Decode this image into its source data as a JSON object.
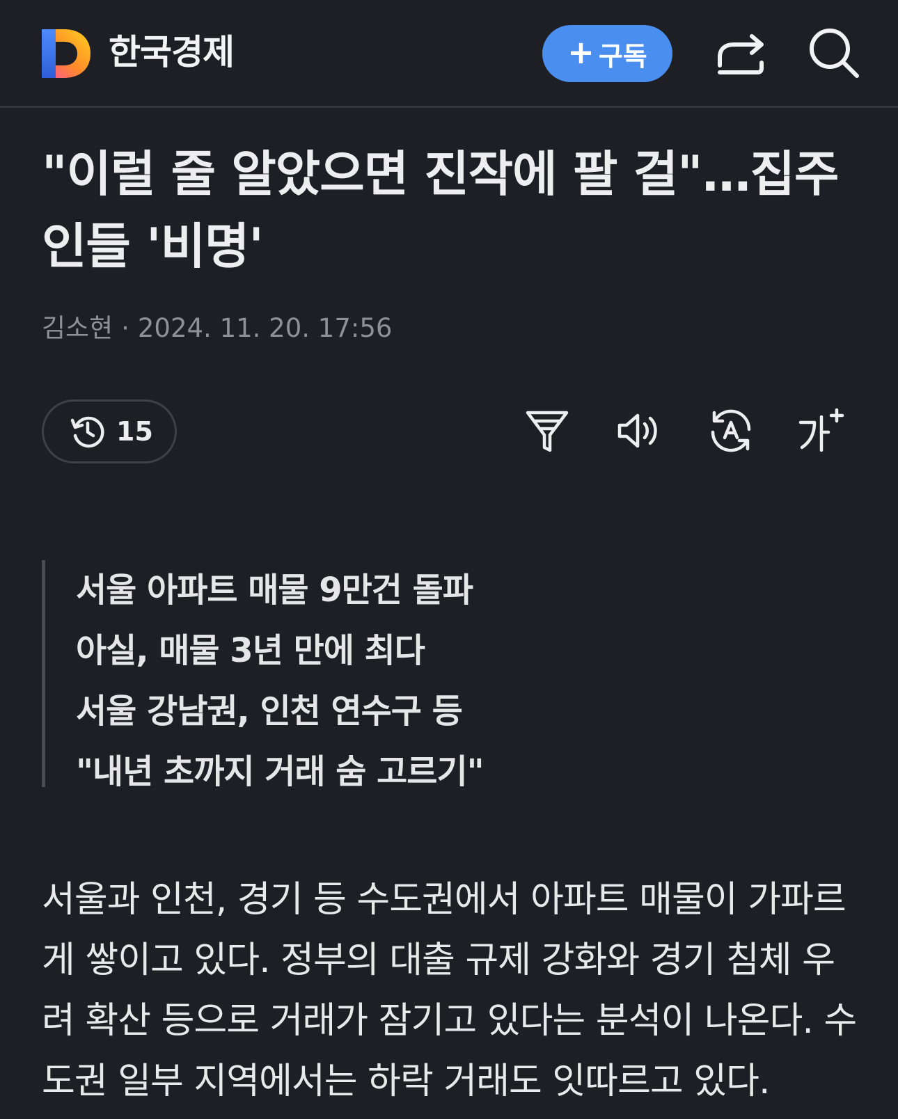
{
  "header": {
    "logo_letter": "D",
    "brand": "한국경제",
    "subscribe_plus": "+",
    "subscribe_label": "구독",
    "share_icon": "share-icon",
    "search_icon": "search-icon"
  },
  "article": {
    "title": "\"이럴 줄 알았으면 진작에 팔 걸\"…집주인들 '비명'",
    "author": "김소현",
    "separator": "·",
    "datetime": "2024. 11. 20. 17:56",
    "read_count": "15",
    "tools": [
      "filter-icon",
      "speaker-icon",
      "translate-icon",
      "font-size-icon"
    ],
    "summary": [
      "서울 아파트 매물 9만건 돌파",
      "아실, 매물 3년 만에 최다",
      "서울 강남권, 인천 연수구 등",
      "\"내년 초까지 거래 숨 고르기\""
    ],
    "body": "서울과 인천, 경기 등 수도권에서 아파트 매물이 가파르게 쌓이고 있다. 정부의 대출 규제 강화와 경기 침체 우려 확산 등으로 거래가 잠기고 있다는 분석이 나온다. 수도권 일부 지역에서는 하락 거래도 잇따르고 있다."
  },
  "colors": {
    "background": "#1d1f24",
    "accent": "#4a8ff0",
    "muted_text": "#8f9197"
  }
}
